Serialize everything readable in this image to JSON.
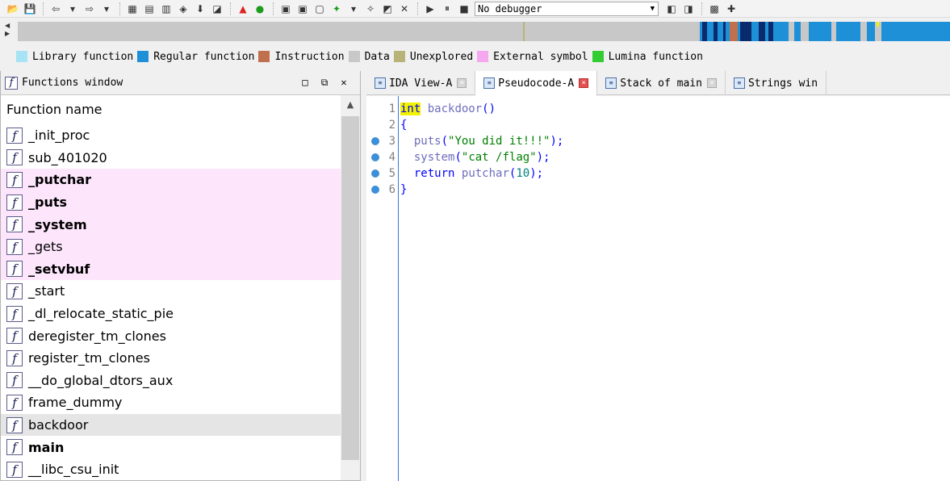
{
  "toolbar": {
    "debugger_select": "No debugger"
  },
  "legend": [
    {
      "label": "Library function",
      "color": "#a7e3f5"
    },
    {
      "label": "Regular function",
      "color": "#1e90d8"
    },
    {
      "label": "Instruction",
      "color": "#c0704c"
    },
    {
      "label": "Data",
      "color": "#c8c8c8"
    },
    {
      "label": "Unexplored",
      "color": "#b8b478"
    },
    {
      "label": "External symbol",
      "color": "#f5a8f0"
    },
    {
      "label": "Lumina function",
      "color": "#33cc33"
    }
  ],
  "functions_window": {
    "title": "Functions window",
    "column_header": "Function name",
    "items": [
      {
        "name": "_init_proc",
        "style": "normal"
      },
      {
        "name": "sub_401020",
        "style": "normal"
      },
      {
        "name": "_putchar",
        "style": "external"
      },
      {
        "name": "_puts",
        "style": "external"
      },
      {
        "name": "_system",
        "style": "external"
      },
      {
        "name": "_gets",
        "style": "external-light"
      },
      {
        "name": "_setvbuf",
        "style": "external"
      },
      {
        "name": "_start",
        "style": "normal"
      },
      {
        "name": "_dl_relocate_static_pie",
        "style": "normal"
      },
      {
        "name": "deregister_tm_clones",
        "style": "normal"
      },
      {
        "name": "register_tm_clones",
        "style": "normal"
      },
      {
        "name": "__do_global_dtors_aux",
        "style": "normal"
      },
      {
        "name": "frame_dummy",
        "style": "normal"
      },
      {
        "name": "backdoor",
        "style": "selected"
      },
      {
        "name": "main",
        "style": "bold"
      },
      {
        "name": "__libc_csu_init",
        "style": "normal"
      }
    ]
  },
  "tabs": [
    {
      "label": "IDA View-A",
      "active": false
    },
    {
      "label": "Pseudocode-A",
      "active": true
    },
    {
      "label": "Stack of main",
      "active": false
    },
    {
      "label": "Strings win",
      "active": false
    }
  ],
  "code": {
    "lines": [
      {
        "num": "1",
        "breakpoint": false,
        "text": "int backdoor()"
      },
      {
        "num": "2",
        "breakpoint": false,
        "text": "{"
      },
      {
        "num": "3",
        "breakpoint": true,
        "text": "  puts(\"You did it!!!\");"
      },
      {
        "num": "4",
        "breakpoint": true,
        "text": "  system(\"cat /flag\");"
      },
      {
        "num": "5",
        "breakpoint": true,
        "text": "  return putchar(10);"
      },
      {
        "num": "6",
        "breakpoint": true,
        "text": "}"
      }
    ]
  }
}
